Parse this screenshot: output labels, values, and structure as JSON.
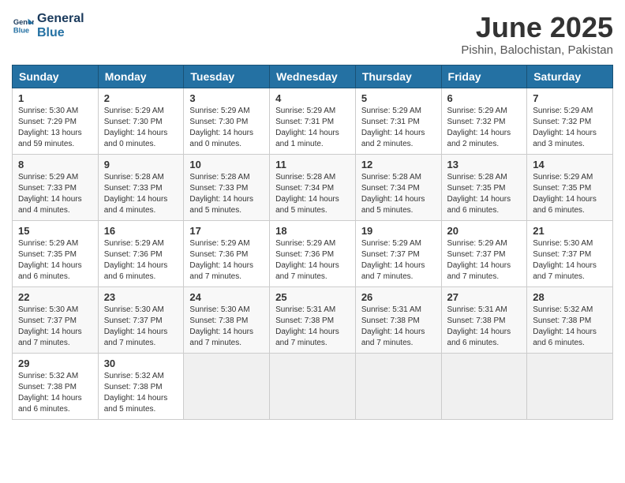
{
  "header": {
    "logo_line1": "General",
    "logo_line2": "Blue",
    "month": "June 2025",
    "location": "Pishin, Balochistan, Pakistan"
  },
  "weekdays": [
    "Sunday",
    "Monday",
    "Tuesday",
    "Wednesday",
    "Thursday",
    "Friday",
    "Saturday"
  ],
  "weeks": [
    [
      {
        "day": 1,
        "info": "Sunrise: 5:30 AM\nSunset: 7:29 PM\nDaylight: 13 hours\nand 59 minutes."
      },
      {
        "day": 2,
        "info": "Sunrise: 5:29 AM\nSunset: 7:30 PM\nDaylight: 14 hours\nand 0 minutes."
      },
      {
        "day": 3,
        "info": "Sunrise: 5:29 AM\nSunset: 7:30 PM\nDaylight: 14 hours\nand 0 minutes."
      },
      {
        "day": 4,
        "info": "Sunrise: 5:29 AM\nSunset: 7:31 PM\nDaylight: 14 hours\nand 1 minute."
      },
      {
        "day": 5,
        "info": "Sunrise: 5:29 AM\nSunset: 7:31 PM\nDaylight: 14 hours\nand 2 minutes."
      },
      {
        "day": 6,
        "info": "Sunrise: 5:29 AM\nSunset: 7:32 PM\nDaylight: 14 hours\nand 2 minutes."
      },
      {
        "day": 7,
        "info": "Sunrise: 5:29 AM\nSunset: 7:32 PM\nDaylight: 14 hours\nand 3 minutes."
      }
    ],
    [
      {
        "day": 8,
        "info": "Sunrise: 5:29 AM\nSunset: 7:33 PM\nDaylight: 14 hours\nand 4 minutes."
      },
      {
        "day": 9,
        "info": "Sunrise: 5:28 AM\nSunset: 7:33 PM\nDaylight: 14 hours\nand 4 minutes."
      },
      {
        "day": 10,
        "info": "Sunrise: 5:28 AM\nSunset: 7:33 PM\nDaylight: 14 hours\nand 5 minutes."
      },
      {
        "day": 11,
        "info": "Sunrise: 5:28 AM\nSunset: 7:34 PM\nDaylight: 14 hours\nand 5 minutes."
      },
      {
        "day": 12,
        "info": "Sunrise: 5:28 AM\nSunset: 7:34 PM\nDaylight: 14 hours\nand 5 minutes."
      },
      {
        "day": 13,
        "info": "Sunrise: 5:28 AM\nSunset: 7:35 PM\nDaylight: 14 hours\nand 6 minutes."
      },
      {
        "day": 14,
        "info": "Sunrise: 5:29 AM\nSunset: 7:35 PM\nDaylight: 14 hours\nand 6 minutes."
      }
    ],
    [
      {
        "day": 15,
        "info": "Sunrise: 5:29 AM\nSunset: 7:35 PM\nDaylight: 14 hours\nand 6 minutes."
      },
      {
        "day": 16,
        "info": "Sunrise: 5:29 AM\nSunset: 7:36 PM\nDaylight: 14 hours\nand 6 minutes."
      },
      {
        "day": 17,
        "info": "Sunrise: 5:29 AM\nSunset: 7:36 PM\nDaylight: 14 hours\nand 7 minutes."
      },
      {
        "day": 18,
        "info": "Sunrise: 5:29 AM\nSunset: 7:36 PM\nDaylight: 14 hours\nand 7 minutes."
      },
      {
        "day": 19,
        "info": "Sunrise: 5:29 AM\nSunset: 7:37 PM\nDaylight: 14 hours\nand 7 minutes."
      },
      {
        "day": 20,
        "info": "Sunrise: 5:29 AM\nSunset: 7:37 PM\nDaylight: 14 hours\nand 7 minutes."
      },
      {
        "day": 21,
        "info": "Sunrise: 5:30 AM\nSunset: 7:37 PM\nDaylight: 14 hours\nand 7 minutes."
      }
    ],
    [
      {
        "day": 22,
        "info": "Sunrise: 5:30 AM\nSunset: 7:37 PM\nDaylight: 14 hours\nand 7 minutes."
      },
      {
        "day": 23,
        "info": "Sunrise: 5:30 AM\nSunset: 7:37 PM\nDaylight: 14 hours\nand 7 minutes."
      },
      {
        "day": 24,
        "info": "Sunrise: 5:30 AM\nSunset: 7:38 PM\nDaylight: 14 hours\nand 7 minutes."
      },
      {
        "day": 25,
        "info": "Sunrise: 5:31 AM\nSunset: 7:38 PM\nDaylight: 14 hours\nand 7 minutes."
      },
      {
        "day": 26,
        "info": "Sunrise: 5:31 AM\nSunset: 7:38 PM\nDaylight: 14 hours\nand 7 minutes."
      },
      {
        "day": 27,
        "info": "Sunrise: 5:31 AM\nSunset: 7:38 PM\nDaylight: 14 hours\nand 6 minutes."
      },
      {
        "day": 28,
        "info": "Sunrise: 5:32 AM\nSunset: 7:38 PM\nDaylight: 14 hours\nand 6 minutes."
      }
    ],
    [
      {
        "day": 29,
        "info": "Sunrise: 5:32 AM\nSunset: 7:38 PM\nDaylight: 14 hours\nand 6 minutes."
      },
      {
        "day": 30,
        "info": "Sunrise: 5:32 AM\nSunset: 7:38 PM\nDaylight: 14 hours\nand 5 minutes."
      },
      null,
      null,
      null,
      null,
      null
    ]
  ]
}
